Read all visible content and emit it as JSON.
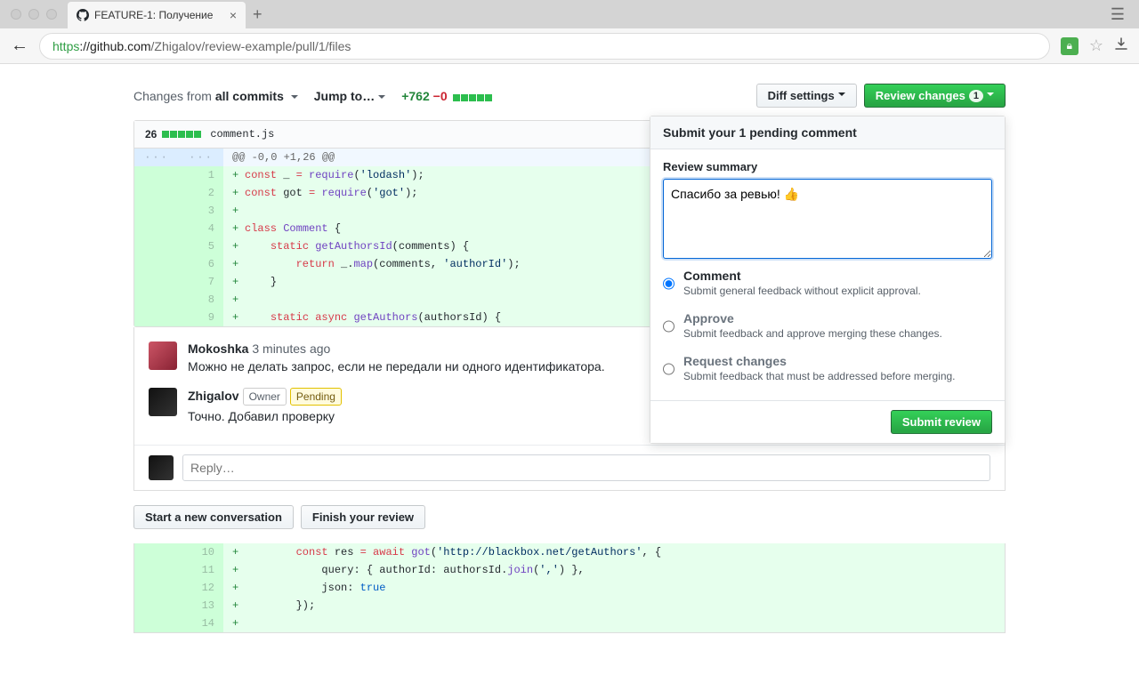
{
  "browser": {
    "tab_title": "FEATURE-1: Получение",
    "url_protocol": "https",
    "url_host": "://github.com",
    "url_path": "/Zhigalov/review-example/pull/1/files"
  },
  "toolbar": {
    "changes_from_prefix": "Changes from ",
    "changes_from_value": "all commits",
    "jump_to": "Jump to…",
    "additions": "+762",
    "deletions": "−0",
    "diff_settings": "Diff settings",
    "review_changes": "Review changes",
    "review_count": "1"
  },
  "review": {
    "header": "Submit your 1 pending comment",
    "summary_label": "Review summary",
    "summary_value": "Спасибо за ревью! 👍",
    "options": [
      {
        "label": "Comment",
        "desc": "Submit general feedback without explicit approval.",
        "checked": true
      },
      {
        "label": "Approve",
        "desc": "Submit feedback and approve merging these changes.",
        "checked": false
      },
      {
        "label": "Request changes",
        "desc": "Submit feedback that must be addressed before merging.",
        "checked": false
      }
    ],
    "submit": "Submit review"
  },
  "file": {
    "lines": "26",
    "name": "comment.js",
    "hunk": "@@ -0,0 +1,26 @@"
  },
  "code_lines_1": [
    {
      "n": "1",
      "tokens": [
        [
          "kw",
          "const"
        ],
        [
          "",
          " _ "
        ],
        [
          "op",
          "="
        ],
        [
          "",
          " "
        ],
        [
          "fn",
          "require"
        ],
        [
          "punct",
          "("
        ],
        [
          "str",
          "'lodash'"
        ],
        [
          "punct",
          ");"
        ]
      ]
    },
    {
      "n": "2",
      "tokens": [
        [
          "kw",
          "const"
        ],
        [
          "",
          " got "
        ],
        [
          "op",
          "="
        ],
        [
          "",
          " "
        ],
        [
          "fn",
          "require"
        ],
        [
          "punct",
          "("
        ],
        [
          "str",
          "'got'"
        ],
        [
          "punct",
          ");"
        ]
      ]
    },
    {
      "n": "3",
      "tokens": []
    },
    {
      "n": "4",
      "tokens": [
        [
          "kw",
          "class"
        ],
        [
          "",
          " "
        ],
        [
          "cls",
          "Comment"
        ],
        [
          "",
          " "
        ],
        [
          "punct",
          "{"
        ]
      ]
    },
    {
      "n": "5",
      "tokens": [
        [
          "",
          "    "
        ],
        [
          "kw",
          "static"
        ],
        [
          "",
          " "
        ],
        [
          "fn",
          "getAuthorsId"
        ],
        [
          "punct",
          "("
        ],
        [
          "",
          "comments"
        ],
        [
          "punct",
          ")"
        ],
        [
          "",
          " "
        ],
        [
          "punct",
          "{"
        ]
      ]
    },
    {
      "n": "6",
      "tokens": [
        [
          "",
          "        "
        ],
        [
          "kw",
          "return"
        ],
        [
          "",
          " _"
        ],
        [
          "punct",
          "."
        ],
        [
          "fn",
          "map"
        ],
        [
          "punct",
          "("
        ],
        [
          "",
          "comments"
        ],
        [
          "punct",
          ", "
        ],
        [
          "str",
          "'authorId'"
        ],
        [
          "punct",
          ");"
        ]
      ]
    },
    {
      "n": "7",
      "tokens": [
        [
          "",
          "    "
        ],
        [
          "punct",
          "}"
        ]
      ]
    },
    {
      "n": "8",
      "tokens": []
    },
    {
      "n": "9",
      "tokens": [
        [
          "",
          "    "
        ],
        [
          "kw",
          "static"
        ],
        [
          "",
          " "
        ],
        [
          "kw",
          "async"
        ],
        [
          "",
          " "
        ],
        [
          "fn",
          "getAuthors"
        ],
        [
          "punct",
          "("
        ],
        [
          "",
          "authorsId"
        ],
        [
          "punct",
          ")"
        ],
        [
          "",
          " "
        ],
        [
          "punct",
          "{"
        ]
      ]
    }
  ],
  "code_lines_2": [
    {
      "n": "10",
      "tokens": [
        [
          "",
          "        "
        ],
        [
          "kw",
          "const"
        ],
        [
          "",
          " "
        ],
        [
          "",
          "res"
        ],
        [
          "",
          " "
        ],
        [
          "op",
          "="
        ],
        [
          "",
          " "
        ],
        [
          "kw",
          "await"
        ],
        [
          "",
          " "
        ],
        [
          "fn",
          "got"
        ],
        [
          "punct",
          "("
        ],
        [
          "str",
          "'http://blackbox.net/getAuthors'"
        ],
        [
          "punct",
          ", "
        ],
        [
          "punct",
          "{"
        ]
      ]
    },
    {
      "n": "11",
      "tokens": [
        [
          "",
          "            "
        ],
        [
          "",
          "query"
        ],
        [
          "punct",
          ":"
        ],
        [
          "",
          " "
        ],
        [
          "punct",
          "{"
        ],
        [
          "",
          " authorId"
        ],
        [
          "punct",
          ":"
        ],
        [
          "",
          " authorsId"
        ],
        [
          "punct",
          "."
        ],
        [
          "fn",
          "join"
        ],
        [
          "punct",
          "("
        ],
        [
          "str",
          "','"
        ],
        [
          "punct",
          ")"
        ],
        [
          "",
          " "
        ],
        [
          "punct",
          "}"
        ],
        [
          "punct",
          ","
        ]
      ]
    },
    {
      "n": "12",
      "tokens": [
        [
          "",
          "            "
        ],
        [
          "",
          "json"
        ],
        [
          "punct",
          ":"
        ],
        [
          "",
          " "
        ],
        [
          "bool",
          "true"
        ]
      ]
    },
    {
      "n": "13",
      "tokens": [
        [
          "",
          "        "
        ],
        [
          "punct",
          "});"
        ]
      ]
    },
    {
      "n": "14",
      "tokens": []
    }
  ],
  "comments": [
    {
      "author": "Mokoshka",
      "time": "3 minutes ago",
      "badges": [],
      "text": "Можно не делать запрос, если не передали ни одного идентификатора.",
      "avatar": "mo"
    },
    {
      "author": "Zhigalov",
      "time": "",
      "badges": [
        "Owner",
        "Pending"
      ],
      "text": "Точно. Добавил проверку",
      "avatar": "zh"
    }
  ],
  "reply_placeholder": "Reply…",
  "actions": {
    "start_conv": "Start a new conversation",
    "finish": "Finish your review"
  }
}
